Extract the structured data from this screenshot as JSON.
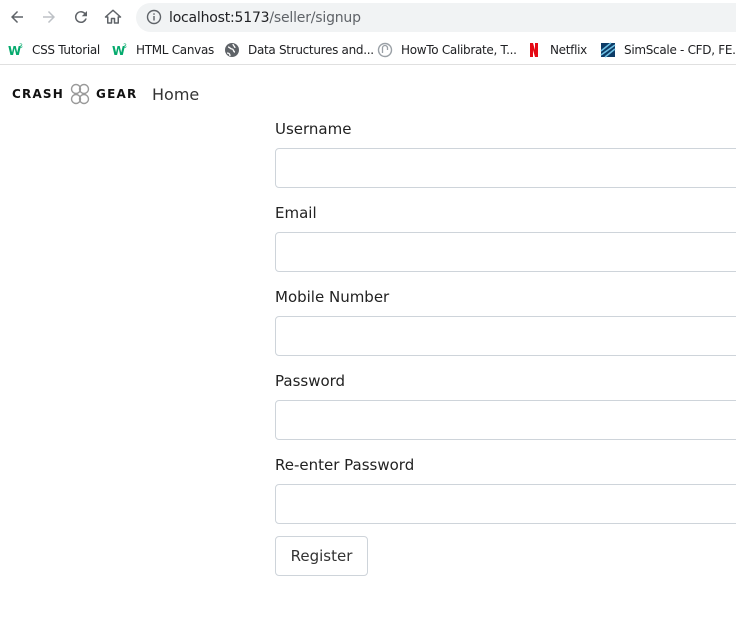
{
  "browser": {
    "url_host": "localhost:5173",
    "url_path": "/seller/signup",
    "bookmarks": [
      {
        "label": "CSS Tutorial",
        "icon": "w3schools-icon"
      },
      {
        "label": "HTML Canvas",
        "icon": "w3schools-icon"
      },
      {
        "label": "Data Structures and...",
        "icon": "globe-icon"
      },
      {
        "label": "HowTo Calibrate, T...",
        "icon": "howto-icon"
      },
      {
        "label": "Netflix",
        "icon": "netflix-icon"
      },
      {
        "label": "SimScale - CFD, FE...",
        "icon": "simscale-icon"
      }
    ]
  },
  "header": {
    "brand_left": "CRASH",
    "brand_right": "GEAR",
    "home_label": "Home"
  },
  "form": {
    "username_label": "Username",
    "email_label": "Email",
    "mobile_label": "Mobile Number",
    "password_label": "Password",
    "reenter_label": "Re-enter Password",
    "register_label": "Register"
  },
  "colors": {
    "w3_green": "#04aa6d",
    "netflix_red": "#e50914"
  }
}
